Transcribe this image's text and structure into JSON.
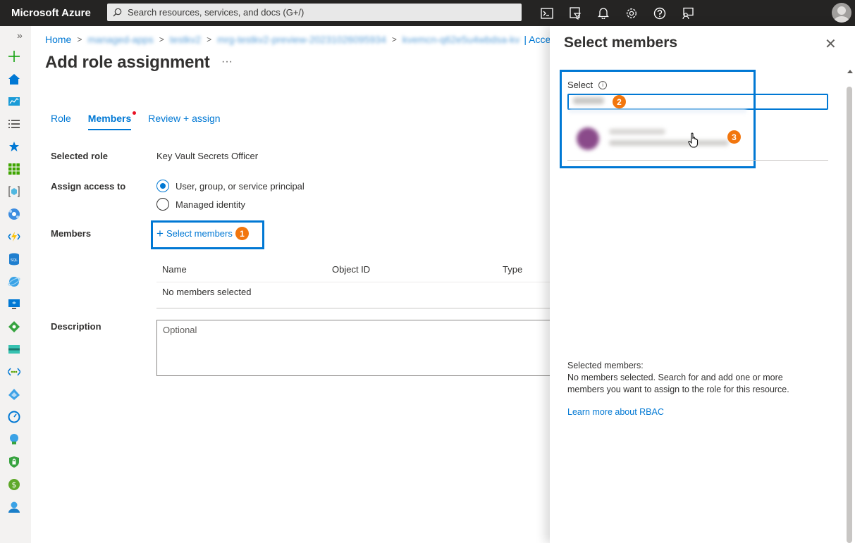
{
  "topbar": {
    "brand": "Microsoft Azure",
    "search_placeholder": "Search resources, services, and docs (G+/)",
    "icons": [
      "terminal-icon",
      "directory-filter-icon",
      "notifications-icon",
      "settings-icon",
      "help-icon",
      "feedback-icon"
    ]
  },
  "leftnav": {
    "expand_label": "»",
    "icons": [
      "create-resource-icon",
      "home-icon",
      "dashboard-icon",
      "all-services-icon",
      "favorites-icon",
      "all-resources-icon",
      "resource-groups-icon",
      "app-services-icon",
      "function-apps-icon",
      "sql-databases-icon",
      "cosmos-db-icon",
      "virtual-machines-icon",
      "load-balancers-icon",
      "storage-accounts-icon",
      "virtual-networks-icon",
      "azure-ad-icon",
      "monitor-icon",
      "advisor-icon",
      "security-center-icon",
      "cost-management-icon",
      "help-support-icon"
    ]
  },
  "breadcrumb": {
    "home": "Home",
    "hidden_items": [
      "managed-apps",
      "testkv2",
      "mrg-testkv2-preview-20231026095934",
      "kvemcn-q62e5u4wbdsa-kv"
    ],
    "tail": "| Acces"
  },
  "page": {
    "title": "Add role assignment",
    "more": "···"
  },
  "tabs": [
    {
      "label": "Role"
    },
    {
      "label": "Members"
    },
    {
      "label": "Review + assign"
    }
  ],
  "form": {
    "selected_role_label": "Selected role",
    "selected_role_value": "Key Vault Secrets Officer",
    "assign_access_label": "Assign access to",
    "assign_options": [
      "User, group, or service principal",
      "Managed identity"
    ],
    "members_label": "Members",
    "select_members": "Select members",
    "table_headers": [
      "Name",
      "Object ID",
      "Type"
    ],
    "table_empty": "No members selected",
    "description_label": "Description",
    "description_placeholder": "Optional"
  },
  "steps": [
    "1",
    "2",
    "3"
  ],
  "panel": {
    "title": "Select members",
    "close": "✕",
    "select_label": "Select",
    "selected_members_heading": "Selected members:",
    "selected_members_text": "No members selected. Search for and add one or more members you want to assign to the role for this resource.",
    "learn_more": "Learn more about RBAC"
  },
  "colors": {
    "accent": "#0078d4",
    "step_badge": "#f2760e",
    "topbar": "#252423"
  }
}
